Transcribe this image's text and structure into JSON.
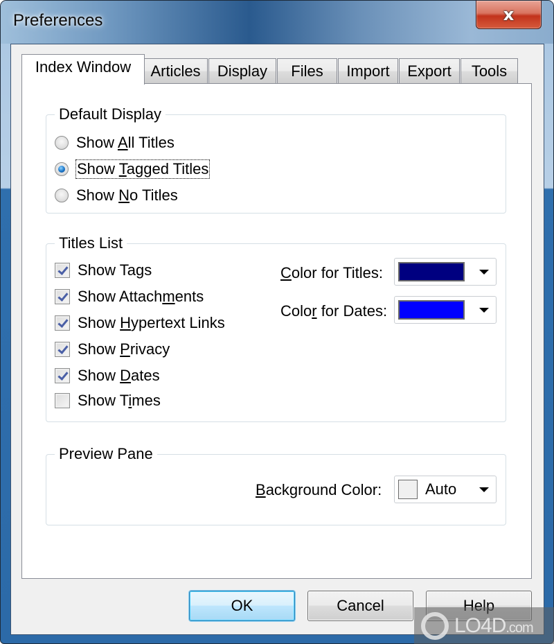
{
  "window": {
    "title": "Preferences",
    "close_glyph": "x"
  },
  "tabs": [
    {
      "label": "Index Window",
      "active": true
    },
    {
      "label": "Articles",
      "active": false
    },
    {
      "label": "Display",
      "active": false
    },
    {
      "label": "Files",
      "active": false
    },
    {
      "label": "Import",
      "active": false
    },
    {
      "label": "Export",
      "active": false
    },
    {
      "label": "Tools",
      "active": false
    }
  ],
  "default_display": {
    "label": "Default Display",
    "options": [
      {
        "pre": "Show ",
        "mnemonic": "A",
        "post": "ll Titles",
        "checked": false
      },
      {
        "pre": "Show ",
        "mnemonic": "T",
        "post": "agged Titles",
        "checked": true
      },
      {
        "pre": "Show ",
        "mnemonic": "N",
        "post": "o Titles",
        "checked": false
      }
    ]
  },
  "titles_list": {
    "label": "Titles List",
    "checkboxes": [
      {
        "pre": "Show Ta",
        "mnemonic": "g",
        "post": "s",
        "checked": true
      },
      {
        "pre": "Show Attach",
        "mnemonic": "m",
        "post": "ents",
        "checked": true
      },
      {
        "pre": "Show ",
        "mnemonic": "H",
        "post": "ypertext Links",
        "checked": true
      },
      {
        "pre": "Show ",
        "mnemonic": "P",
        "post": "rivacy",
        "checked": true
      },
      {
        "pre": "Show ",
        "mnemonic": "D",
        "post": "ates",
        "checked": true
      },
      {
        "pre": "Show T",
        "mnemonic": "i",
        "post": "mes",
        "checked": false
      }
    ],
    "color_titles": {
      "pre": "",
      "mnemonic": "C",
      "post": "olor for Titles:",
      "color": "#000080"
    },
    "color_dates": {
      "pre": "Colo",
      "mnemonic": "r",
      "post": " for Dates:",
      "color": "#0000ff"
    }
  },
  "preview_pane": {
    "label": "Preview Pane",
    "background": {
      "pre": "",
      "mnemonic": "B",
      "post": "ackground Color:",
      "value": "Auto",
      "color": "#f0f0f0"
    }
  },
  "buttons": {
    "ok": "OK",
    "cancel": "Cancel",
    "help": "Help"
  },
  "watermark": {
    "text": "LO4D",
    "suffix": ".com"
  }
}
